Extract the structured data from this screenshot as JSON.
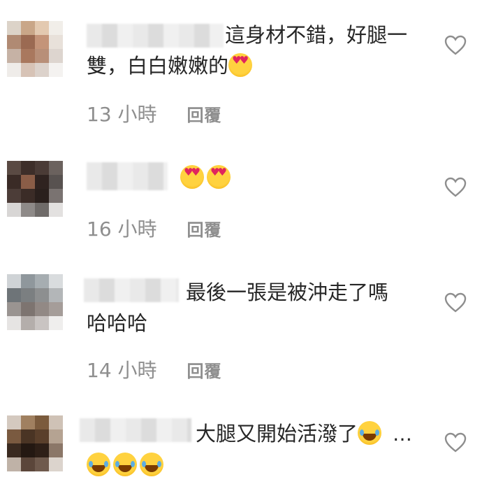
{
  "comments": [
    {
      "text_line1": "這身材不錯，好腿一",
      "text_line2": "雙，白白嫩嫩的",
      "emojis": [
        "smiling-face-with-heart-eyes"
      ],
      "time": "13 小時",
      "reply": "回覆"
    },
    {
      "text_line1": "",
      "emojis": [
        "smiling-face-with-heart-eyes",
        "smiling-face-with-heart-eyes"
      ],
      "time": "16 小時",
      "reply": "回覆"
    },
    {
      "text_line1": "最後一張是被沖走了嗎",
      "text_line2": "哈哈哈",
      "time": "14 小時",
      "reply": "回覆"
    },
    {
      "text_line1": "大腿又開始活潑了",
      "more": "…",
      "emojis": [
        "face-with-tears-of-joy",
        "face-with-tears-of-joy",
        "face-with-tears-of-joy",
        "face-with-tears-of-joy"
      ]
    }
  ],
  "icons": {
    "like": "heart-outline-icon"
  },
  "colors": {
    "text": "#262626",
    "meta": "#8e8e8e"
  }
}
